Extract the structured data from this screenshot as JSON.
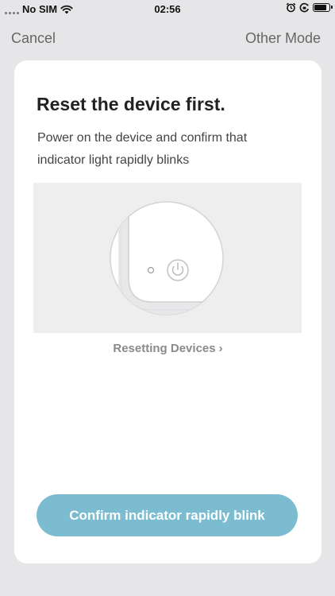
{
  "status_bar": {
    "carrier": "No SIM",
    "time": "02:56"
  },
  "nav": {
    "cancel_label": "Cancel",
    "other_mode_label": "Other Mode"
  },
  "content": {
    "title": "Reset the device first.",
    "description": "Power on the device and confirm that indicator light rapidly blinks",
    "reset_link_label": "Resetting Devices",
    "confirm_label": "Confirm indicator rapidly blink"
  },
  "colors": {
    "background": "#e6e6e8",
    "card": "#ffffff",
    "button": "#7cbcd0",
    "illustration_bg": "#eeeeef"
  },
  "icons": {
    "wifi": "wifi-icon",
    "alarm": "alarm-icon",
    "rotation_lock": "rotation-lock-icon",
    "battery": "battery-icon",
    "power": "power-icon",
    "chevron": "chevron-right-icon"
  }
}
